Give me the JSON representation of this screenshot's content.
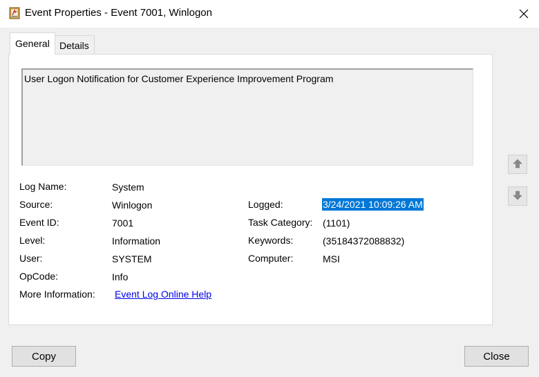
{
  "window": {
    "title": "Event Properties - Event 7001, Winlogon",
    "icon": "event-viewer-icon",
    "close_icon": "close-icon"
  },
  "tabs": [
    {
      "label": "General",
      "active": true
    },
    {
      "label": "Details",
      "active": false
    }
  ],
  "description": "User Logon Notification for Customer Experience Improvement Program",
  "fields": {
    "log_name": {
      "label": "Log Name:",
      "value": "System"
    },
    "source": {
      "label": "Source:",
      "value": "Winlogon"
    },
    "event_id": {
      "label": "Event ID:",
      "value": "7001"
    },
    "level": {
      "label": "Level:",
      "value": "Information"
    },
    "user": {
      "label": "User:",
      "value": "SYSTEM"
    },
    "opcode": {
      "label": "OpCode:",
      "value": "Info"
    },
    "more_info": {
      "label": "More Information:",
      "value": "Event Log Online Help"
    },
    "logged": {
      "label": "Logged:",
      "value": "3/24/2021 10:09:26 AM"
    },
    "task_category": {
      "label": "Task Category:",
      "value": "(1101)"
    },
    "keywords": {
      "label": "Keywords:",
      "value": "(35184372088832)"
    },
    "computer": {
      "label": "Computer:",
      "value": "MSI"
    }
  },
  "side_buttons": {
    "up_icon": "arrow-up-icon",
    "down_icon": "arrow-down-icon"
  },
  "buttons": {
    "copy": "Copy",
    "close": "Close"
  },
  "colors": {
    "selection": "#0078d7",
    "link": "#0000ee"
  }
}
